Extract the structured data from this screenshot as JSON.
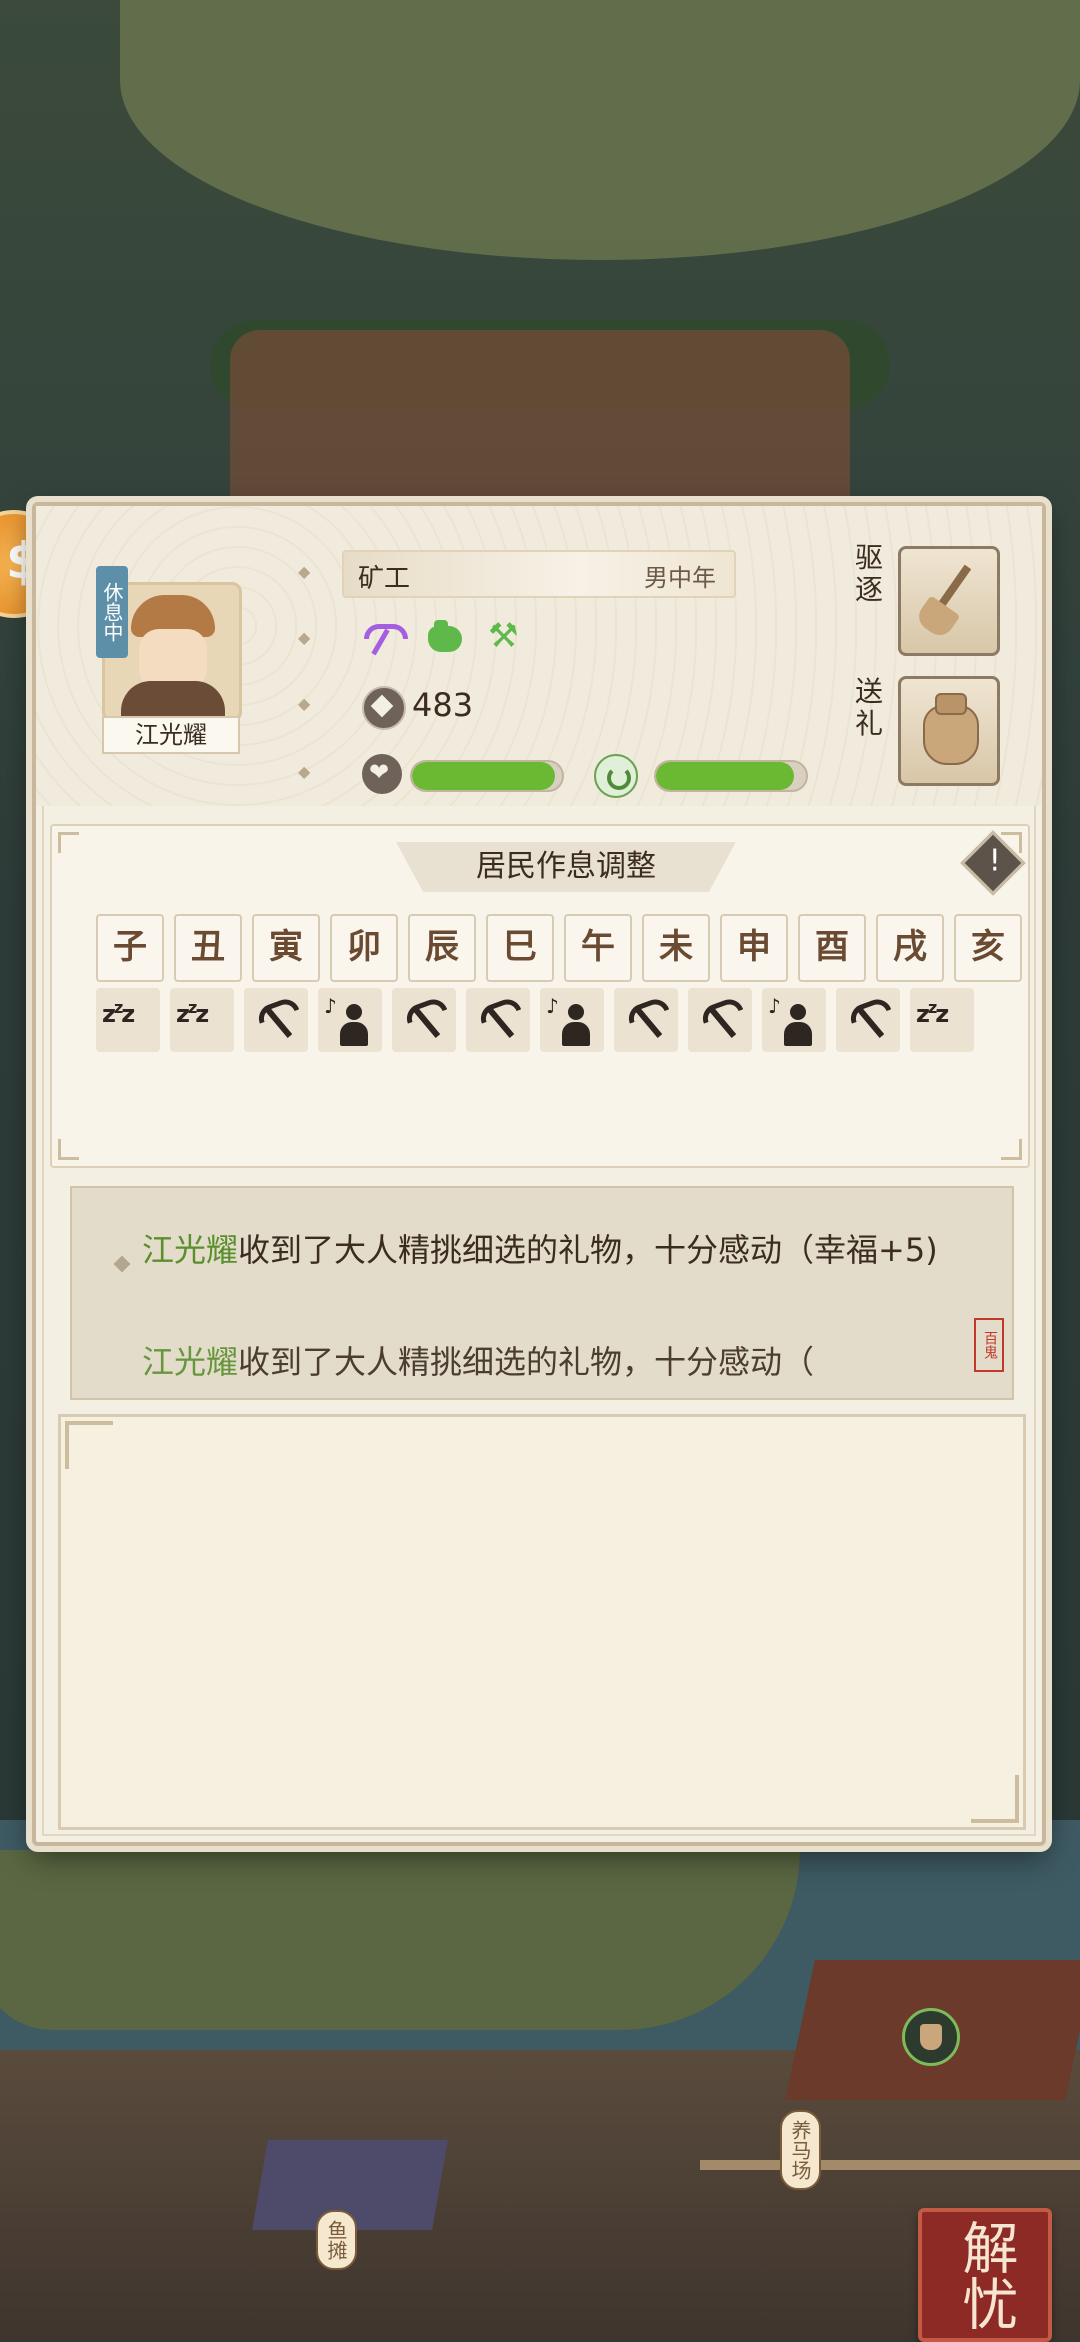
{
  "resident": {
    "status": "休息中",
    "name": "江光耀",
    "profession": "矿工",
    "gender_age": "男中年",
    "money": "483",
    "happiness_fraction": 0.95,
    "health_fraction": 0.92,
    "skill_icons": [
      "pickaxe-icon",
      "bag-icon",
      "crossed-tools-icon"
    ]
  },
  "actions": {
    "expel_label": "驱逐",
    "gift_label": "送礼"
  },
  "schedule": {
    "title": "居民作息调整",
    "hours": [
      "子",
      "丑",
      "寅",
      "卯",
      "辰",
      "巳",
      "午",
      "未",
      "申",
      "酉",
      "戌",
      "亥"
    ],
    "activities": [
      "sleep",
      "sleep",
      "work",
      "leisure",
      "work",
      "work",
      "leisure",
      "work",
      "work",
      "leisure",
      "work",
      "sleep"
    ]
  },
  "log": {
    "line1_name": "江光耀",
    "line1_text": "收到了大人精挑细选的礼物，十分感动（幸福+5)",
    "line2_name": "江光耀",
    "line2_text": "收到了大人精挑细选的礼物，十分感动（",
    "seal_text": "百鬼"
  },
  "map": {
    "corner_seal": "解忧",
    "flag_ranch": "养马场",
    "flag_fishing": "鱼摊"
  },
  "colors": {
    "accent_green": "#6bb833",
    "name_green": "#5b8f2d",
    "status_blue": "#5e8fa8",
    "panel_bg": "#f4efe3"
  }
}
